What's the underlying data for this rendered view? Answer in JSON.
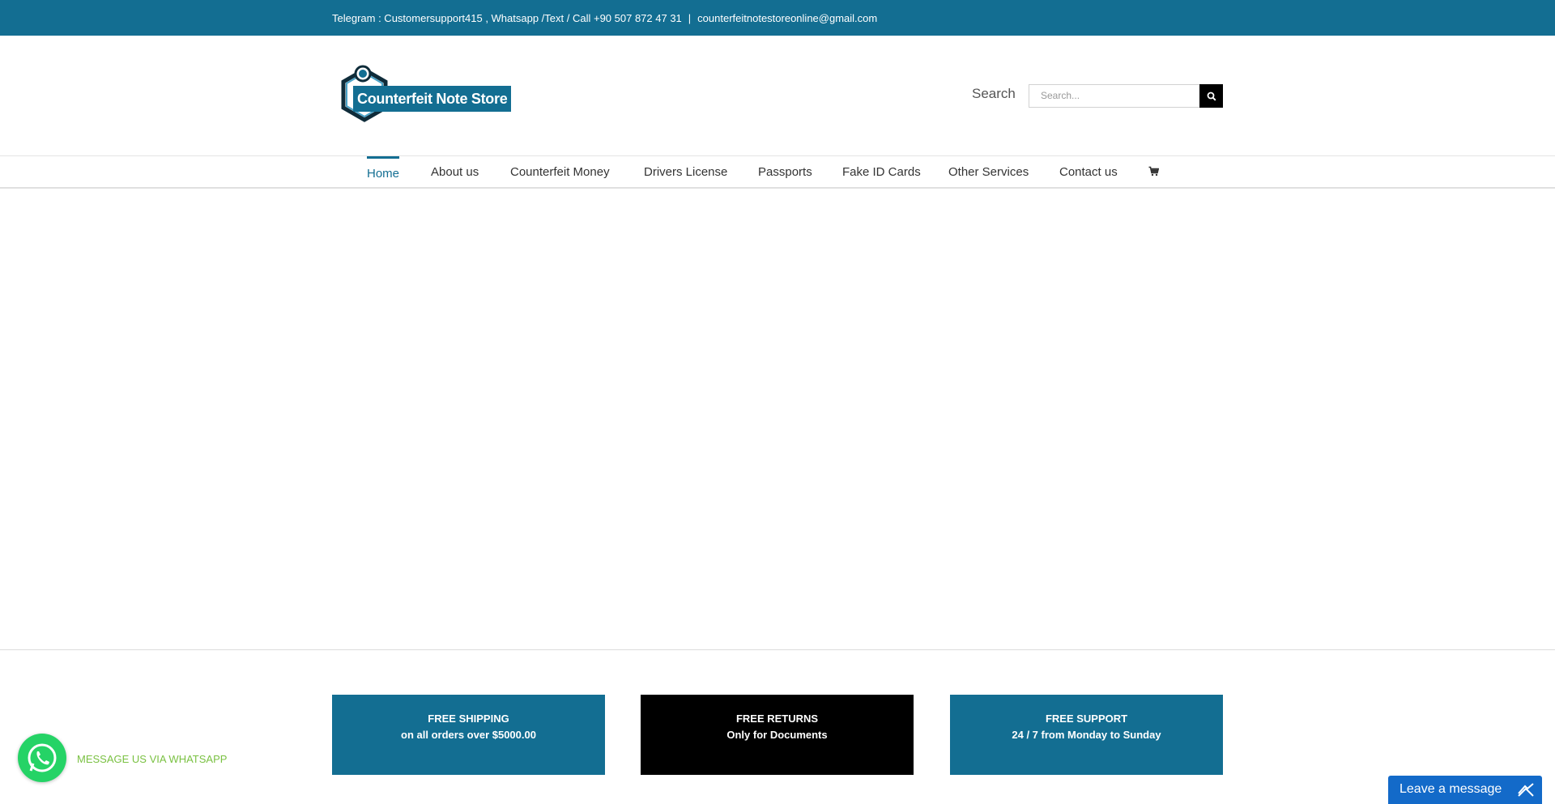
{
  "topbar": {
    "contact_text": "Telegram : Customersupport415 , Whatsapp /Text / Call +90 507 872 47 31",
    "separator": "|",
    "email": "counterfeitnotestoreonline@gmail.com"
  },
  "header": {
    "logo_text": "Counterfeit Note Store",
    "search_label": "Search",
    "search_placeholder": "Search..."
  },
  "nav": {
    "items": [
      {
        "label": "Home"
      },
      {
        "label": "About us"
      },
      {
        "label": "Counterfeit Money"
      },
      {
        "label": "Drivers License"
      },
      {
        "label": "Passports"
      },
      {
        "label": "Fake ID Cards"
      },
      {
        "label": "Other Services"
      },
      {
        "label": "Contact us"
      }
    ],
    "cart_icon": "cart-icon"
  },
  "features": [
    {
      "title": "FREE SHIPPING",
      "subtitle": "on all orders over $5000.00"
    },
    {
      "title": "FREE RETURNS",
      "subtitle": "Only for Documents"
    },
    {
      "title": "FREE SUPPORT",
      "subtitle": "24 / 7 from Monday to Sunday"
    }
  ],
  "whatsapp": {
    "label": "MESSAGE US VIA WHATSAPP"
  },
  "chat": {
    "label": "Leave a message"
  },
  "colors": {
    "brand": "#136e92",
    "whatsapp": "#25d366",
    "chat": "#136ac9"
  }
}
